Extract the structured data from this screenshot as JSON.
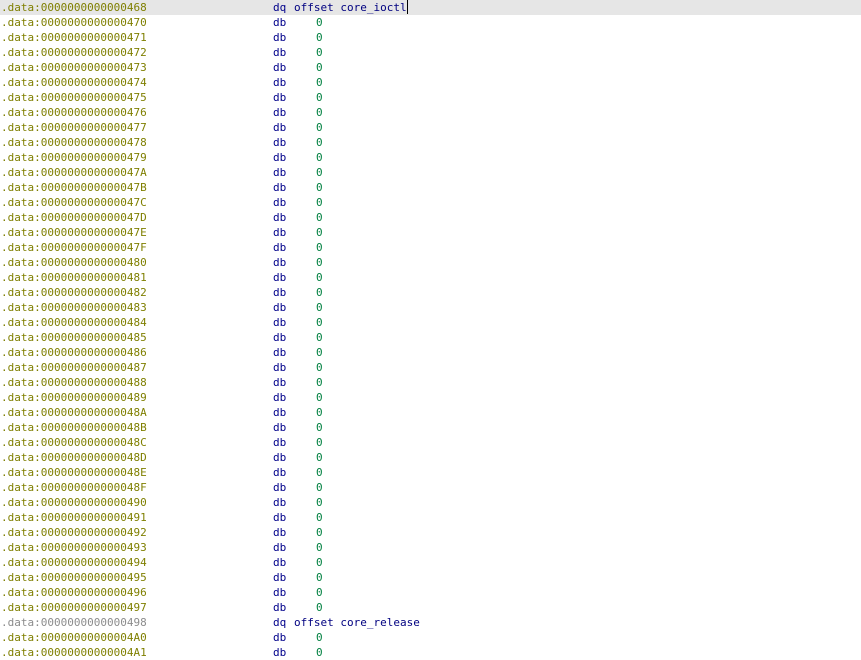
{
  "listing": {
    "rows": [
      {
        "addr": ".data:0000000000000468",
        "mnem": "dq",
        "kind": "offset",
        "keyword": "offset",
        "symbol": "core_ioctl",
        "current": true,
        "grey": false
      },
      {
        "addr": ".data:0000000000000470",
        "mnem": "db",
        "kind": "num",
        "value": "0"
      },
      {
        "addr": ".data:0000000000000471",
        "mnem": "db",
        "kind": "num",
        "value": "0"
      },
      {
        "addr": ".data:0000000000000472",
        "mnem": "db",
        "kind": "num",
        "value": "0"
      },
      {
        "addr": ".data:0000000000000473",
        "mnem": "db",
        "kind": "num",
        "value": "0"
      },
      {
        "addr": ".data:0000000000000474",
        "mnem": "db",
        "kind": "num",
        "value": "0"
      },
      {
        "addr": ".data:0000000000000475",
        "mnem": "db",
        "kind": "num",
        "value": "0"
      },
      {
        "addr": ".data:0000000000000476",
        "mnem": "db",
        "kind": "num",
        "value": "0"
      },
      {
        "addr": ".data:0000000000000477",
        "mnem": "db",
        "kind": "num",
        "value": "0"
      },
      {
        "addr": ".data:0000000000000478",
        "mnem": "db",
        "kind": "num",
        "value": "0"
      },
      {
        "addr": ".data:0000000000000479",
        "mnem": "db",
        "kind": "num",
        "value": "0"
      },
      {
        "addr": ".data:000000000000047A",
        "mnem": "db",
        "kind": "num",
        "value": "0"
      },
      {
        "addr": ".data:000000000000047B",
        "mnem": "db",
        "kind": "num",
        "value": "0"
      },
      {
        "addr": ".data:000000000000047C",
        "mnem": "db",
        "kind": "num",
        "value": "0"
      },
      {
        "addr": ".data:000000000000047D",
        "mnem": "db",
        "kind": "num",
        "value": "0"
      },
      {
        "addr": ".data:000000000000047E",
        "mnem": "db",
        "kind": "num",
        "value": "0"
      },
      {
        "addr": ".data:000000000000047F",
        "mnem": "db",
        "kind": "num",
        "value": "0"
      },
      {
        "addr": ".data:0000000000000480",
        "mnem": "db",
        "kind": "num",
        "value": "0"
      },
      {
        "addr": ".data:0000000000000481",
        "mnem": "db",
        "kind": "num",
        "value": "0"
      },
      {
        "addr": ".data:0000000000000482",
        "mnem": "db",
        "kind": "num",
        "value": "0"
      },
      {
        "addr": ".data:0000000000000483",
        "mnem": "db",
        "kind": "num",
        "value": "0"
      },
      {
        "addr": ".data:0000000000000484",
        "mnem": "db",
        "kind": "num",
        "value": "0"
      },
      {
        "addr": ".data:0000000000000485",
        "mnem": "db",
        "kind": "num",
        "value": "0"
      },
      {
        "addr": ".data:0000000000000486",
        "mnem": "db",
        "kind": "num",
        "value": "0"
      },
      {
        "addr": ".data:0000000000000487",
        "mnem": "db",
        "kind": "num",
        "value": "0"
      },
      {
        "addr": ".data:0000000000000488",
        "mnem": "db",
        "kind": "num",
        "value": "0"
      },
      {
        "addr": ".data:0000000000000489",
        "mnem": "db",
        "kind": "num",
        "value": "0"
      },
      {
        "addr": ".data:000000000000048A",
        "mnem": "db",
        "kind": "num",
        "value": "0"
      },
      {
        "addr": ".data:000000000000048B",
        "mnem": "db",
        "kind": "num",
        "value": "0"
      },
      {
        "addr": ".data:000000000000048C",
        "mnem": "db",
        "kind": "num",
        "value": "0"
      },
      {
        "addr": ".data:000000000000048D",
        "mnem": "db",
        "kind": "num",
        "value": "0"
      },
      {
        "addr": ".data:000000000000048E",
        "mnem": "db",
        "kind": "num",
        "value": "0"
      },
      {
        "addr": ".data:000000000000048F",
        "mnem": "db",
        "kind": "num",
        "value": "0"
      },
      {
        "addr": ".data:0000000000000490",
        "mnem": "db",
        "kind": "num",
        "value": "0"
      },
      {
        "addr": ".data:0000000000000491",
        "mnem": "db",
        "kind": "num",
        "value": "0"
      },
      {
        "addr": ".data:0000000000000492",
        "mnem": "db",
        "kind": "num",
        "value": "0"
      },
      {
        "addr": ".data:0000000000000493",
        "mnem": "db",
        "kind": "num",
        "value": "0"
      },
      {
        "addr": ".data:0000000000000494",
        "mnem": "db",
        "kind": "num",
        "value": "0"
      },
      {
        "addr": ".data:0000000000000495",
        "mnem": "db",
        "kind": "num",
        "value": "0"
      },
      {
        "addr": ".data:0000000000000496",
        "mnem": "db",
        "kind": "num",
        "value": "0"
      },
      {
        "addr": ".data:0000000000000497",
        "mnem": "db",
        "kind": "num",
        "value": "0"
      },
      {
        "addr": ".data:0000000000000498",
        "mnem": "dq",
        "kind": "offset",
        "keyword": "offset",
        "symbol": "core_release",
        "current": false,
        "grey": true
      },
      {
        "addr": ".data:00000000000004A0",
        "mnem": "db",
        "kind": "num",
        "value": "0"
      },
      {
        "addr": ".data:00000000000004A1",
        "mnem": "db",
        "kind": "num",
        "value": "0"
      }
    ]
  },
  "colors": {
    "address": "#7f7f00",
    "address_muted": "#8c8c8c",
    "mnemonic": "#00008b",
    "number": "#008040",
    "symbol": "#000080",
    "current_line_bg": "#e6e6e6"
  }
}
